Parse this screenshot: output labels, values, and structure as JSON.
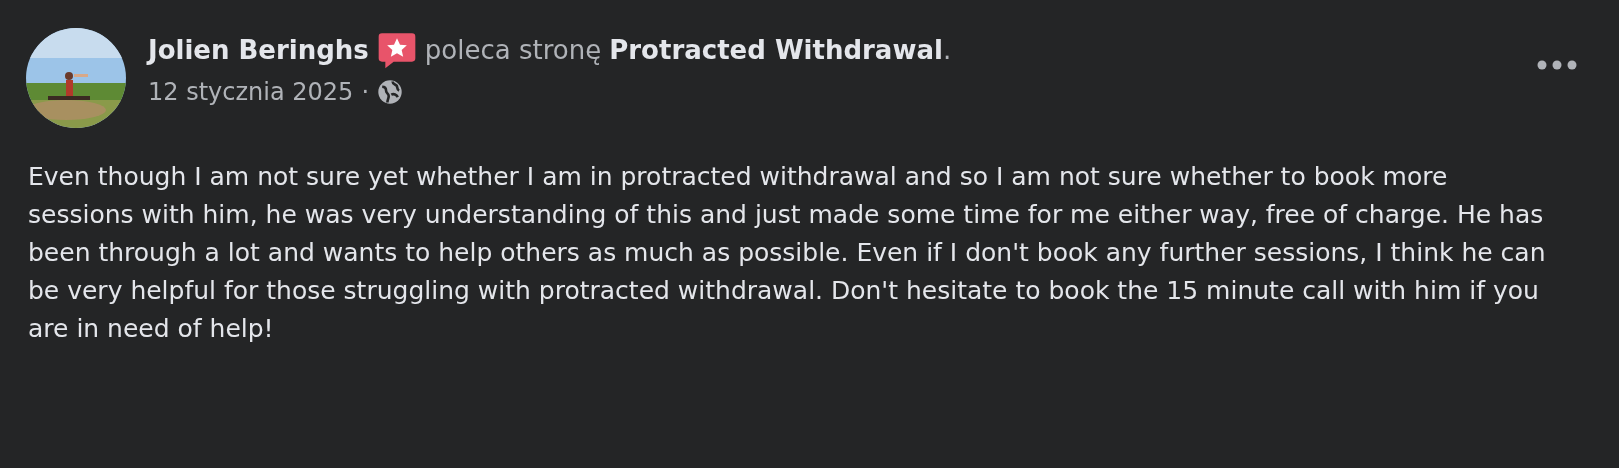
{
  "post": {
    "author": "Jolien Beringhs",
    "verb": "poleca stronę",
    "page": "Protracted Withdrawal",
    "period": ".",
    "date": "12 stycznia 2025",
    "separator": "·",
    "body": "Even though I am not sure yet whether I am in protracted withdrawal and so I am not sure whether to book more sessions with him, he was very understanding of this and just made some time for me either way, free of charge. He has been through a lot and wants to help others as much as possible. Even if I don't book any further sessions, I think he can be very helpful for those struggling with protracted withdrawal. Don't hesitate to book the 15 minute call with him if you are in need of help!"
  }
}
